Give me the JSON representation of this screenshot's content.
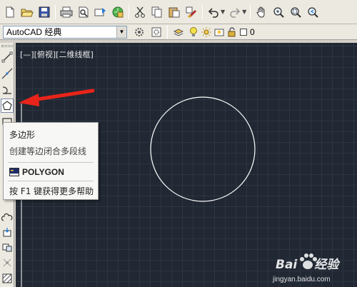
{
  "toolbar_standard": {
    "icons": [
      "new-file-icon",
      "open-file-icon",
      "save-icon",
      "print-icon",
      "print-preview-icon",
      "publish-icon",
      "plot-icon",
      "cut-icon",
      "copy-icon",
      "paste-icon",
      "match-properties-icon",
      "undo-icon",
      "redo-icon",
      "pan-icon",
      "zoom-realtime-icon",
      "zoom-window-icon",
      "zoom-previous-icon"
    ]
  },
  "toolbar_workspace": {
    "workspace_name": "AutoCAD 经典",
    "current_layer": "0"
  },
  "viewport": {
    "label": "[—][俯视][二维线框]",
    "background": "#212833",
    "circle_color": "#ffffff"
  },
  "tooltip": {
    "title": "多边形",
    "description": "创建等边闭合多段线",
    "command": "POLYGON",
    "help_text": "按 F1 键获得更多帮助"
  },
  "annotation": {
    "arrow_color": "#e8241a"
  },
  "watermark": {
    "brand": "Bai经验",
    "url": "jingyan.baidu.com"
  }
}
